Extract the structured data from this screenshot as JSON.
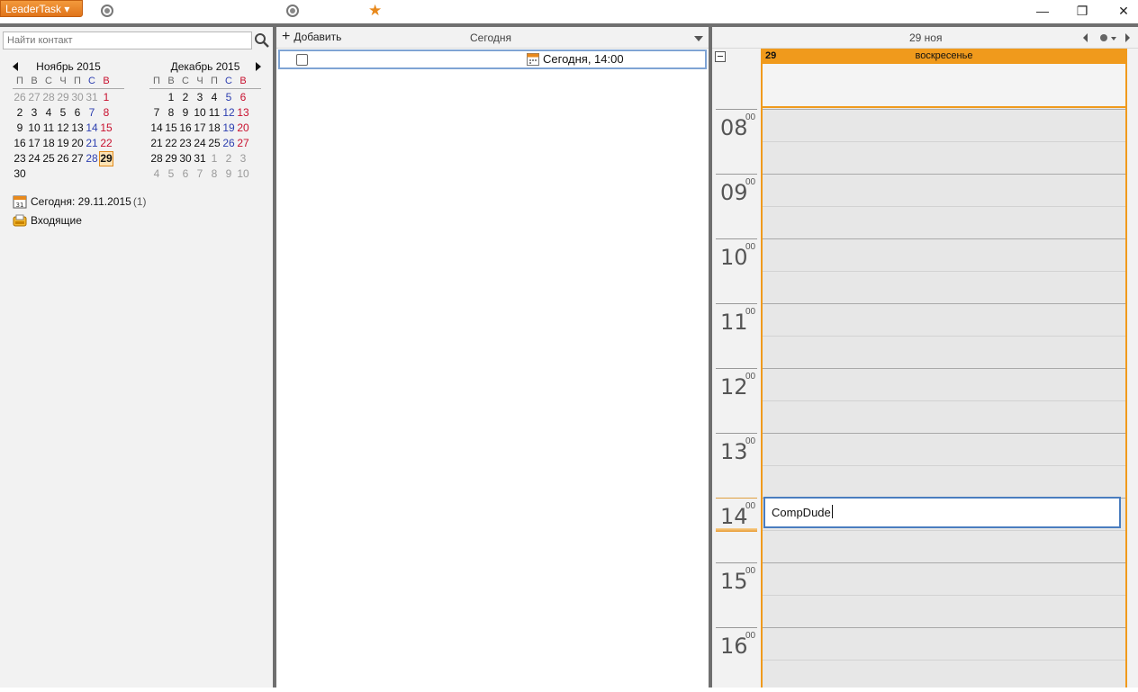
{
  "titlebar": {
    "app_button": "LeaderTask ▾",
    "minimize": "—",
    "restore": "❐",
    "close": "✕"
  },
  "left": {
    "search_placeholder": "Найти контакт",
    "calendars": [
      {
        "title": "Ноябрь 2015",
        "dow": [
          "П",
          "В",
          "С",
          "Ч",
          "П",
          "С",
          "В"
        ],
        "weeks": [
          [
            {
              "d": "26",
              "o": true
            },
            {
              "d": "27",
              "o": true
            },
            {
              "d": "28",
              "o": true
            },
            {
              "d": "29",
              "o": true
            },
            {
              "d": "30",
              "o": true
            },
            {
              "d": "31",
              "o": true
            },
            {
              "d": "1"
            }
          ],
          [
            {
              "d": "2"
            },
            {
              "d": "3"
            },
            {
              "d": "4"
            },
            {
              "d": "5"
            },
            {
              "d": "6"
            },
            {
              "d": "7"
            },
            {
              "d": "8"
            }
          ],
          [
            {
              "d": "9"
            },
            {
              "d": "10"
            },
            {
              "d": "11"
            },
            {
              "d": "12"
            },
            {
              "d": "13"
            },
            {
              "d": "14"
            },
            {
              "d": "15"
            }
          ],
          [
            {
              "d": "16"
            },
            {
              "d": "17"
            },
            {
              "d": "18"
            },
            {
              "d": "19"
            },
            {
              "d": "20"
            },
            {
              "d": "21"
            },
            {
              "d": "22"
            }
          ],
          [
            {
              "d": "23"
            },
            {
              "d": "24"
            },
            {
              "d": "25"
            },
            {
              "d": "26"
            },
            {
              "d": "27"
            },
            {
              "d": "28"
            },
            {
              "d": "29",
              "sel": true
            }
          ],
          [
            {
              "d": "30"
            }
          ]
        ]
      },
      {
        "title": "Декабрь 2015",
        "dow": [
          "П",
          "В",
          "С",
          "Ч",
          "П",
          "С",
          "В"
        ],
        "weeks": [
          [
            {
              "d": ""
            },
            {
              "d": "1"
            },
            {
              "d": "2"
            },
            {
              "d": "3"
            },
            {
              "d": "4"
            },
            {
              "d": "5"
            },
            {
              "d": "6"
            }
          ],
          [
            {
              "d": "7"
            },
            {
              "d": "8"
            },
            {
              "d": "9"
            },
            {
              "d": "10"
            },
            {
              "d": "11"
            },
            {
              "d": "12"
            },
            {
              "d": "13"
            }
          ],
          [
            {
              "d": "14"
            },
            {
              "d": "15"
            },
            {
              "d": "16"
            },
            {
              "d": "17"
            },
            {
              "d": "18"
            },
            {
              "d": "19"
            },
            {
              "d": "20"
            }
          ],
          [
            {
              "d": "21"
            },
            {
              "d": "22"
            },
            {
              "d": "23"
            },
            {
              "d": "24"
            },
            {
              "d": "25"
            },
            {
              "d": "26"
            },
            {
              "d": "27"
            }
          ],
          [
            {
              "d": "28"
            },
            {
              "d": "29"
            },
            {
              "d": "30"
            },
            {
              "d": "31"
            },
            {
              "d": "1",
              "o": true
            },
            {
              "d": "2",
              "o": true
            },
            {
              "d": "3",
              "o": true
            }
          ],
          [
            {
              "d": "4",
              "o": true
            },
            {
              "d": "5",
              "o": true
            },
            {
              "d": "6",
              "o": true
            },
            {
              "d": "7",
              "o": true
            },
            {
              "d": "8",
              "o": true
            },
            {
              "d": "9",
              "o": true
            },
            {
              "d": "10",
              "o": true
            }
          ]
        ]
      }
    ],
    "today_label": "Сегодня: 29.11.2015",
    "today_count": "(1)",
    "inbox_label": "Входящие",
    "today_icon_text": "31"
  },
  "middle": {
    "add_label": "Добавить",
    "filter_label": "Сегодня",
    "task_date": "Сегодня, 14:00"
  },
  "right": {
    "date_label": "29 ноя",
    "day_number": "29",
    "day_name": "воскресенье",
    "hours": [
      "08",
      "09",
      "10",
      "11",
      "12",
      "13",
      "14",
      "15",
      "16"
    ],
    "minutes": "00",
    "current_hour": "14",
    "event_text": "CompDude"
  },
  "colors": {
    "accent": "#f09a1c",
    "selection": "#4a7dbf",
    "saturday": "#2d3fb0",
    "sunday": "#c8102e"
  }
}
